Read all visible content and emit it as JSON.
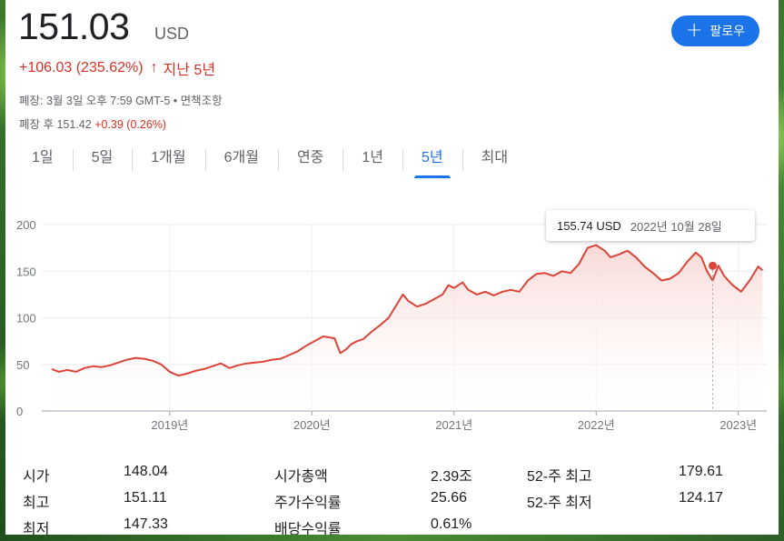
{
  "quote": {
    "price": "151.03",
    "currency": "USD",
    "change": "+106.03 (235.62%)",
    "change_arrow": "↑",
    "period": "지난 5년"
  },
  "follow_button": {
    "icon": "plus-icon",
    "label": "팔로우"
  },
  "meta": {
    "close_info": "폐장: 3월 3일 오후 7:59 GMT-5 • 면책조항",
    "after_hours_label": "폐장 후",
    "after_hours_price": "151.42",
    "after_hours_change": "+0.39 (0.26%)"
  },
  "tabs": [
    "1일",
    "5일",
    "1개월",
    "6개월",
    "연중",
    "1년",
    "5년",
    "최대"
  ],
  "active_tab": "5년",
  "tooltip": {
    "price": "155.74 USD",
    "date": "2022년 10월 28일"
  },
  "chart_data": {
    "type": "area",
    "title": "",
    "xlabel": "",
    "ylabel": "",
    "ylim": [
      0,
      200
    ],
    "yticks": [
      0,
      50,
      100,
      150,
      200
    ],
    "xticks": [
      "2019년",
      "2020년",
      "2021년",
      "2022년",
      "2023년"
    ],
    "grid": true,
    "line_color": "#db4437",
    "fill_color": "#f8d7d4",
    "series": [
      {
        "values": [
          [
            2018.17,
            45
          ],
          [
            2018.22,
            42
          ],
          [
            2018.28,
            44
          ],
          [
            2018.34,
            42
          ],
          [
            2018.4,
            46
          ],
          [
            2018.46,
            48
          ],
          [
            2018.52,
            47
          ],
          [
            2018.58,
            49
          ],
          [
            2018.64,
            52
          ],
          [
            2018.7,
            55
          ],
          [
            2018.76,
            57
          ],
          [
            2018.82,
            56
          ],
          [
            2018.88,
            54
          ],
          [
            2018.94,
            50
          ],
          [
            2019.0,
            42
          ],
          [
            2019.06,
            38
          ],
          [
            2019.12,
            40
          ],
          [
            2019.18,
            43
          ],
          [
            2019.24,
            45
          ],
          [
            2019.3,
            48
          ],
          [
            2019.36,
            51
          ],
          [
            2019.42,
            46
          ],
          [
            2019.48,
            49
          ],
          [
            2019.54,
            51
          ],
          [
            2019.6,
            52
          ],
          [
            2019.66,
            53
          ],
          [
            2019.72,
            55
          ],
          [
            2019.78,
            56
          ],
          [
            2019.84,
            60
          ],
          [
            2019.9,
            64
          ],
          [
            2019.96,
            70
          ],
          [
            2020.02,
            75
          ],
          [
            2020.08,
            80
          ],
          [
            2020.12,
            79
          ],
          [
            2020.16,
            78
          ],
          [
            2020.2,
            62
          ],
          [
            2020.24,
            66
          ],
          [
            2020.28,
            72
          ],
          [
            2020.32,
            75
          ],
          [
            2020.36,
            77
          ],
          [
            2020.42,
            85
          ],
          [
            2020.48,
            92
          ],
          [
            2020.54,
            100
          ],
          [
            2020.6,
            115
          ],
          [
            2020.64,
            125
          ],
          [
            2020.68,
            118
          ],
          [
            2020.74,
            112
          ],
          [
            2020.8,
            115
          ],
          [
            2020.86,
            120
          ],
          [
            2020.92,
            125
          ],
          [
            2020.96,
            135
          ],
          [
            2021.0,
            132
          ],
          [
            2021.06,
            138
          ],
          [
            2021.1,
            130
          ],
          [
            2021.16,
            125
          ],
          [
            2021.22,
            128
          ],
          [
            2021.28,
            124
          ],
          [
            2021.34,
            128
          ],
          [
            2021.4,
            130
          ],
          [
            2021.46,
            128
          ],
          [
            2021.52,
            140
          ],
          [
            2021.58,
            147
          ],
          [
            2021.64,
            148
          ],
          [
            2021.7,
            145
          ],
          [
            2021.76,
            150
          ],
          [
            2021.82,
            148
          ],
          [
            2021.88,
            158
          ],
          [
            2021.94,
            175
          ],
          [
            2022.0,
            178
          ],
          [
            2022.06,
            172
          ],
          [
            2022.1,
            165
          ],
          [
            2022.16,
            168
          ],
          [
            2022.22,
            172
          ],
          [
            2022.28,
            165
          ],
          [
            2022.34,
            155
          ],
          [
            2022.4,
            148
          ],
          [
            2022.46,
            140
          ],
          [
            2022.52,
            142
          ],
          [
            2022.58,
            148
          ],
          [
            2022.64,
            160
          ],
          [
            2022.7,
            170
          ],
          [
            2022.74,
            165
          ],
          [
            2022.78,
            150
          ],
          [
            2022.82,
            140
          ],
          [
            2022.86,
            156
          ],
          [
            2022.9,
            145
          ],
          [
            2022.96,
            135
          ],
          [
            2023.02,
            128
          ],
          [
            2023.08,
            140
          ],
          [
            2023.14,
            155
          ],
          [
            2023.17,
            151
          ]
        ]
      }
    ]
  },
  "stats": {
    "col1": [
      {
        "label": "시가",
        "value": "148.04"
      },
      {
        "label": "최고",
        "value": "151.11"
      },
      {
        "label": "최저",
        "value": "147.33"
      }
    ],
    "col2": [
      {
        "label": "시가총액",
        "value": "2.39조"
      },
      {
        "label": "주가수익률",
        "value": "25.66"
      },
      {
        "label": "배당수익률",
        "value": "0.61%"
      }
    ],
    "col3": [
      {
        "label": "52-주 최고",
        "value": "179.61"
      },
      {
        "label": "52-주 최저",
        "value": "124.17"
      }
    ]
  }
}
